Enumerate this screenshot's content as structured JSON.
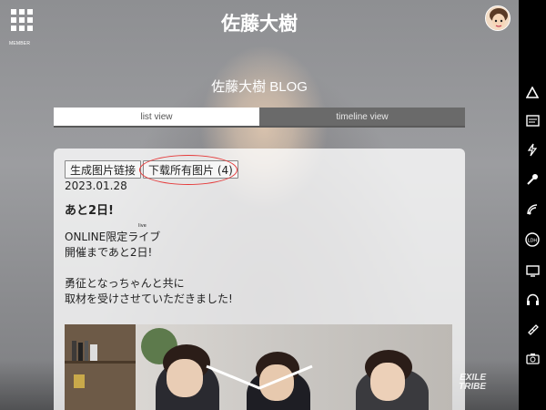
{
  "header": {
    "title": "佐藤大樹",
    "menu_label": "MEMBER"
  },
  "blog": {
    "title": "佐藤大樹 BLOG"
  },
  "tabs": [
    {
      "label": "list view",
      "active": true
    },
    {
      "label": "timeline view",
      "active": false
    }
  ],
  "post": {
    "buttons": {
      "generate_link": "生成图片链接",
      "download_all": "下载所有图片 (4)"
    },
    "date": "2023.01.28",
    "heading": "あと2日!",
    "ruby": "live",
    "lines": [
      "ONLINE限定ライブ",
      "開催まであと2日!",
      "",
      "勇征となっちゃんと共に",
      "取材を受けさせていただきました!"
    ]
  },
  "logo": {
    "line1": "EXILE",
    "line2": "TRIBE"
  },
  "right_bar_icons": [
    "triangle-icon",
    "news-icon",
    "lightning-icon",
    "microphone-icon",
    "broadcast-icon",
    "ldh-logo-icon",
    "tv-icon",
    "headphones-icon",
    "ticket-icon",
    "camera-icon"
  ],
  "colors": {
    "highlight": "#e53a3a",
    "sidebar": "#000000"
  }
}
